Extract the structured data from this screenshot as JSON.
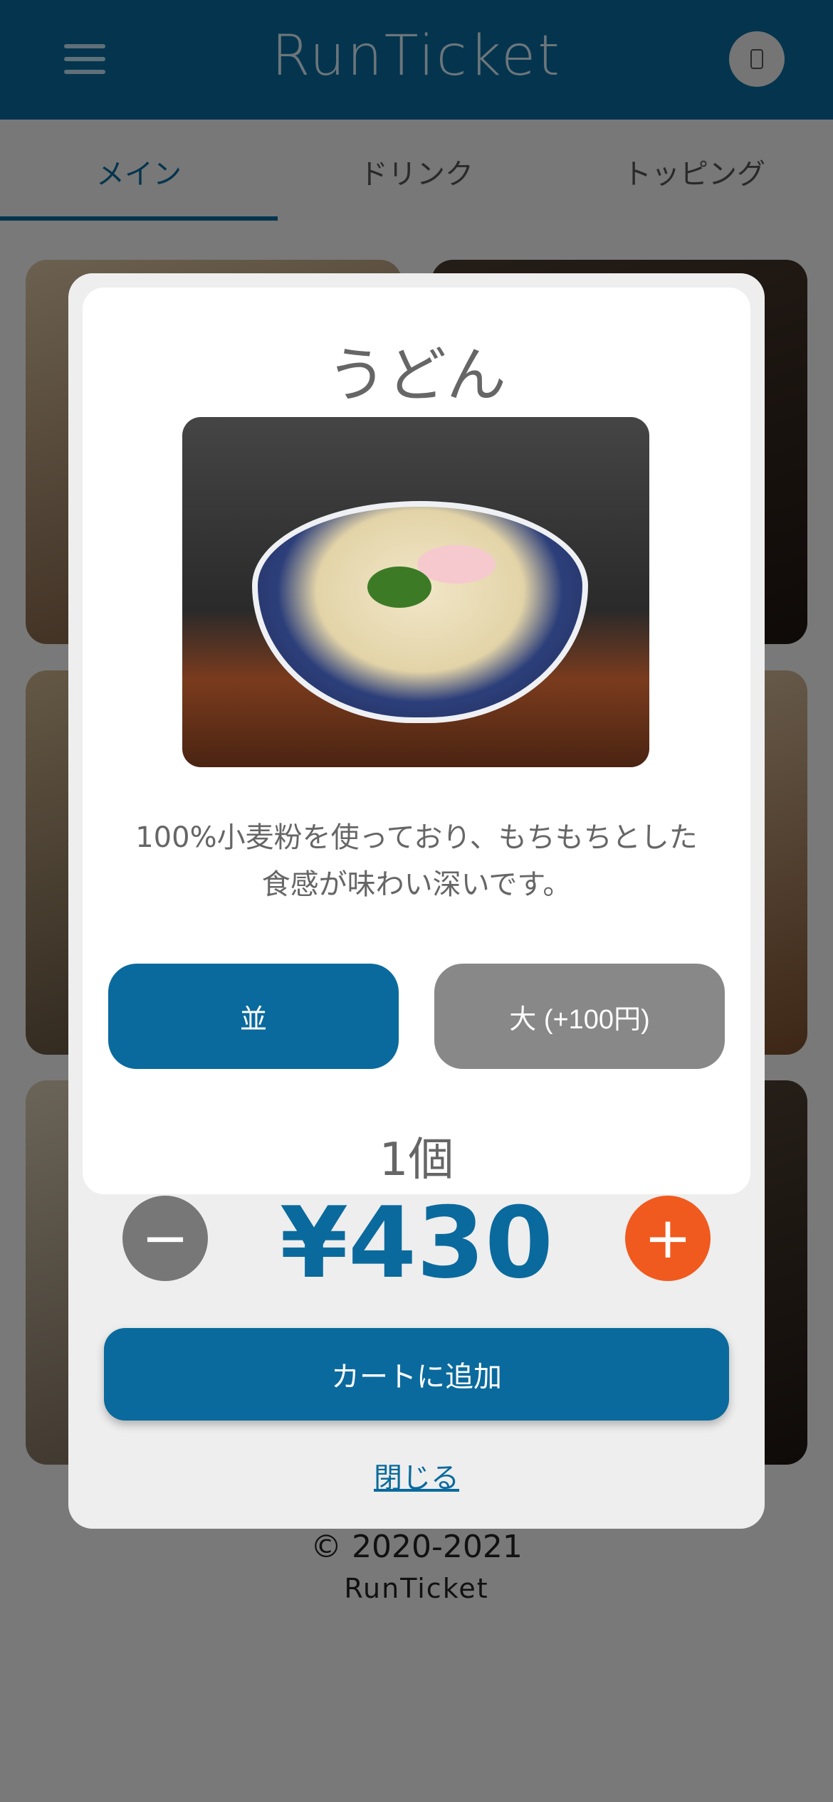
{
  "header": {
    "brand": "RunTicket"
  },
  "tabs": [
    {
      "label": "メイン"
    },
    {
      "label": "ドリンク"
    },
    {
      "label": "トッピング"
    }
  ],
  "footer": {
    "copyright": "© 2020-2021",
    "brand": "RunTicket"
  },
  "modal": {
    "title": "うどん",
    "description": "100%小麦粉を使っており、もちもちとした食感が味わい深いです。",
    "sizes": [
      {
        "label": "並"
      },
      {
        "label": "大 (+100円)"
      }
    ],
    "quantity": "1個",
    "price": "¥430",
    "minus_glyph": "−",
    "plus_glyph": "+",
    "add_to_cart": "カートに追加",
    "close": "閉じる"
  },
  "colors": {
    "primary": "#0a6a9d",
    "accent": "#f05a1e",
    "muted": "#888888"
  }
}
